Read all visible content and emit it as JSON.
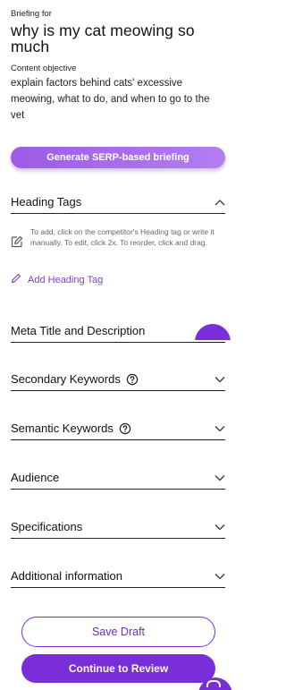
{
  "header": {
    "briefing_for_label": "Briefing for",
    "topic": "why is my cat meowing so much",
    "objective_label": "Content objective",
    "objective_text": "explain factors behind cats' excessive meowing, what to do, and when to go to the vet"
  },
  "generate_button": {
    "label": "Generate SERP-based briefing"
  },
  "sections": {
    "heading_tags": {
      "label": "Heading Tags",
      "expanded": true,
      "help_text": "To add, click on the competitor's Heading tag or write it manually. To edit, click 2x. To reorder, click and drag.",
      "add_label": "Add Heading Tag"
    },
    "meta_title": {
      "label": "Meta Title and Description"
    },
    "secondary_keywords": {
      "label": "Secondary Keywords"
    },
    "semantic_keywords": {
      "label": "Semantic Keywords"
    },
    "audience": {
      "label": "Audience"
    },
    "specifications": {
      "label": "Specifications"
    },
    "additional_information": {
      "label": "Additional information"
    }
  },
  "footer": {
    "save_draft_label": "Save Draft",
    "continue_label": "Continue to Review"
  },
  "colors": {
    "accent": "#7a2ed8",
    "accent_light": "#a86bed",
    "text": "#111111",
    "muted": "#666666"
  },
  "icons": [
    "chevron-up-icon",
    "chevron-down-icon",
    "help-circle-icon",
    "edit-square-icon",
    "pencil-icon",
    "chat-bubble-icon"
  ]
}
